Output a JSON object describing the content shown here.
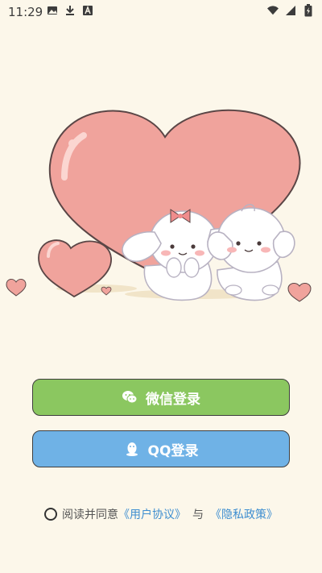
{
  "status_bar": {
    "time": "11:29",
    "left_icons": [
      "image-icon",
      "download-icon",
      "text-a-icon"
    ],
    "right_icons": [
      "wifi-icon",
      "signal-icon",
      "battery-charging-icon"
    ]
  },
  "login": {
    "wechat_label": "微信登录",
    "qq_label": "QQ登录",
    "wechat_color": "#8bc760",
    "qq_color": "#6fb2e6"
  },
  "agreement": {
    "prefix": "阅读并同意",
    "user_agreement": "《用户协议》",
    "conjunction": "与",
    "privacy_policy": "《隐私政策》"
  }
}
